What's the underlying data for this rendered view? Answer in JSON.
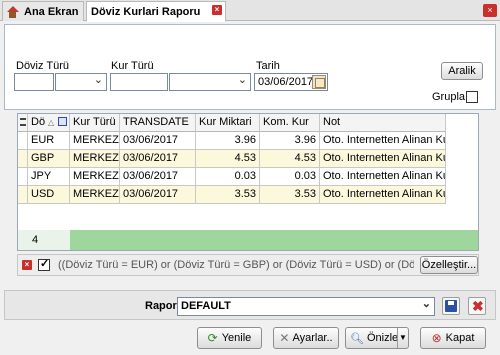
{
  "tabs": {
    "home_label": "Ana Ekran",
    "active_label": "Döviz Kurlari Raporu"
  },
  "filters": {
    "doviz_turu_label": "Döviz Türü",
    "kur_turu_label": "Kur Türü",
    "tarih_label": "Tarih",
    "tarih_value": "03/06/2017",
    "aralik_label": "Aralik",
    "grupla_label": "Grupla"
  },
  "grid": {
    "columns": [
      "Dö",
      "Kur Türü",
      "TRANSDATE",
      "Kur Miktari",
      "Kom. Kur",
      "Not"
    ],
    "rows": [
      [
        "EUR",
        "MERKEZ",
        "03/06/2017",
        "3.96",
        "3.96",
        "Oto. Internetten Alinan Kur"
      ],
      [
        "GBP",
        "MERKEZ",
        "03/06/2017",
        "4.53",
        "4.53",
        "Oto. Internetten Alinan Kur"
      ],
      [
        "JPY",
        "MERKEZ",
        "03/06/2017",
        "0.03",
        "0.03",
        "Oto. Internetten Alinan Kur"
      ],
      [
        "USD",
        "MERKEZ",
        "03/06/2017",
        "3.53",
        "3.53",
        "Oto. Internetten Alinan Kur"
      ]
    ],
    "footer_count": "4"
  },
  "filter_bar": {
    "expression": "((Döviz Türü = EUR) or (Döviz Türü = GBP) or (Döviz Türü = USD) or (Döviz T",
    "customize_label": "Özelleştir..."
  },
  "report": {
    "label": "Rapor",
    "selected": "DEFAULT"
  },
  "actions": {
    "refresh": "Yenile",
    "settings": "Ayarlar..",
    "preview": "Önizle",
    "close": "Kapat"
  },
  "colors": {
    "grid_footer": "#9ed69e",
    "row_alt": "#fcf8dc",
    "close_red": "#c9302c"
  }
}
